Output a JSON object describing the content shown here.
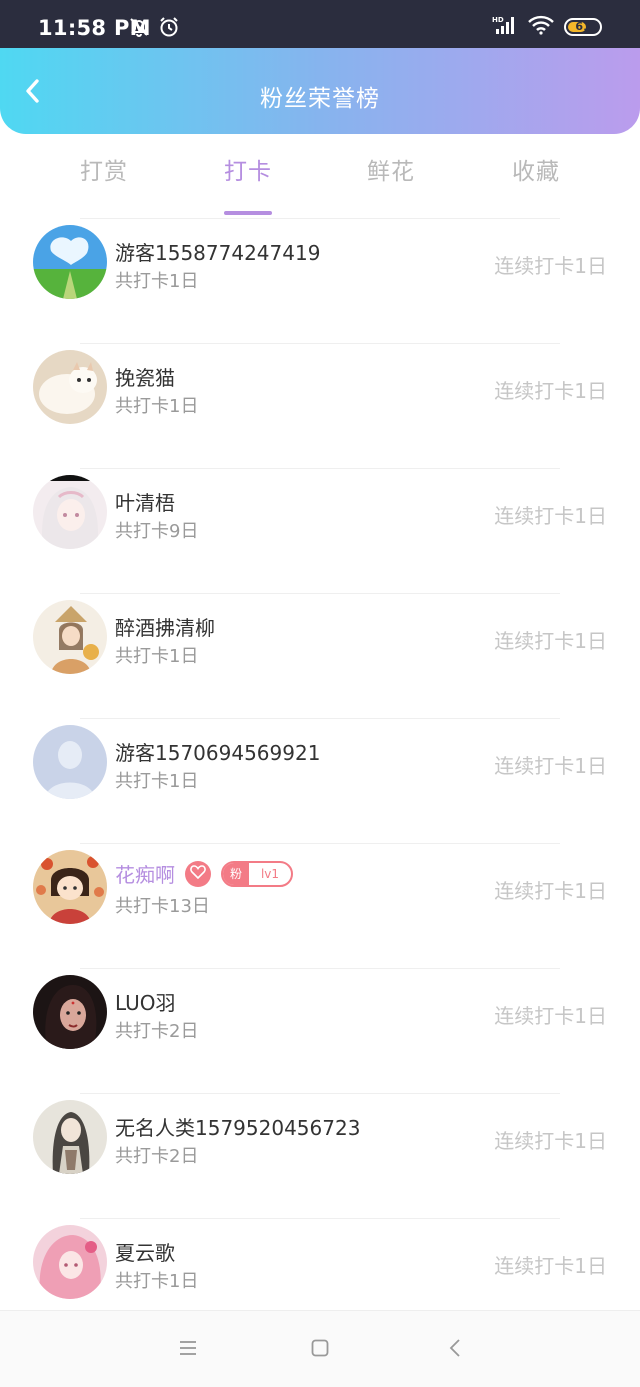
{
  "status_bar": {
    "time": "11:58 PM",
    "battery_level": "61",
    "battery_fraction": 0.61,
    "icons": [
      "mute-bell-icon",
      "alarm-icon",
      "hd-signal-icon",
      "wifi-icon",
      "battery-icon"
    ]
  },
  "header": {
    "title": "粉丝荣誉榜",
    "back_icon": "chevron-left-icon"
  },
  "tabs": [
    {
      "label": "打赏",
      "active": false
    },
    {
      "label": "打卡",
      "active": true
    },
    {
      "label": "鲜花",
      "active": false
    },
    {
      "label": "收藏",
      "active": false
    }
  ],
  "colors": {
    "accent": "#b58ee0",
    "header_gradient": [
      "#4fd8f2",
      "#bb9ced"
    ],
    "badge": "#f37b86"
  },
  "list": [
    {
      "name": "游客1558774247419",
      "total": "共打卡1日",
      "streak": "连续打卡1日"
    },
    {
      "name": "挽瓷猫",
      "total": "共打卡1日",
      "streak": "连续打卡1日"
    },
    {
      "name": "叶清梧",
      "total": "共打卡9日",
      "streak": "连续打卡1日"
    },
    {
      "name": "醉酒拂清柳",
      "total": "共打卡1日",
      "streak": "连续打卡1日"
    },
    {
      "name": "游客1570694569921",
      "total": "共打卡1日",
      "streak": "连续打卡1日"
    },
    {
      "name": "花痴啊",
      "total": "共打卡13日",
      "streak": "连续打卡1日",
      "fan_label": "粉",
      "fan_level": "lv1"
    },
    {
      "name": "LUO羽",
      "total": "共打卡2日",
      "streak": "连续打卡1日"
    },
    {
      "name": "无名人类1579520456723",
      "total": "共打卡2日",
      "streak": "连续打卡1日"
    },
    {
      "name": "夏云歌",
      "total": "共打卡1日",
      "streak": "连续打卡1日"
    }
  ],
  "nav_bar": {
    "icons": [
      "menu-icon",
      "home-square-icon",
      "back-triangle-icon"
    ]
  }
}
